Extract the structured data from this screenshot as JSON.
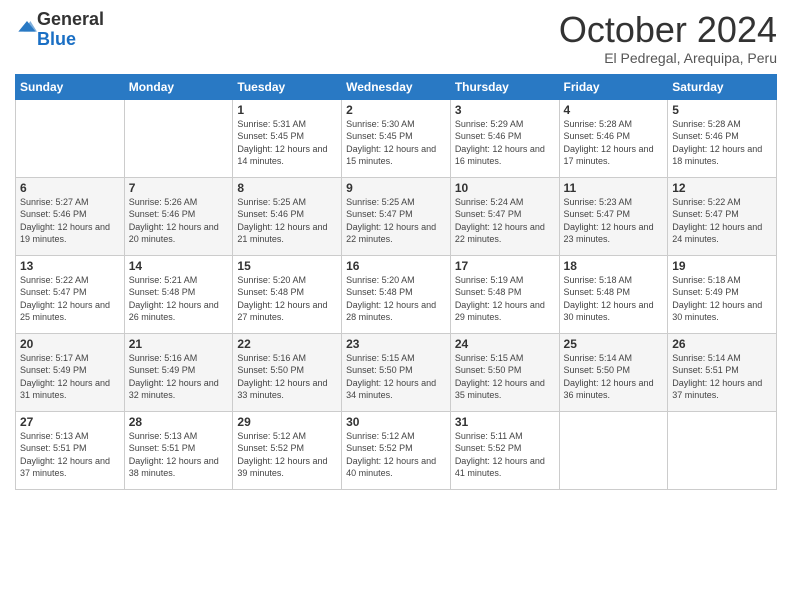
{
  "header": {
    "logo_general": "General",
    "logo_blue": "Blue",
    "month_title": "October 2024",
    "location": "El Pedregal, Arequipa, Peru"
  },
  "weekdays": [
    "Sunday",
    "Monday",
    "Tuesday",
    "Wednesday",
    "Thursday",
    "Friday",
    "Saturday"
  ],
  "weeks": [
    [
      {
        "day": "",
        "sunrise": "",
        "sunset": "",
        "daylight": ""
      },
      {
        "day": "",
        "sunrise": "",
        "sunset": "",
        "daylight": ""
      },
      {
        "day": "1",
        "sunrise": "Sunrise: 5:31 AM",
        "sunset": "Sunset: 5:45 PM",
        "daylight": "Daylight: 12 hours and 14 minutes."
      },
      {
        "day": "2",
        "sunrise": "Sunrise: 5:30 AM",
        "sunset": "Sunset: 5:45 PM",
        "daylight": "Daylight: 12 hours and 15 minutes."
      },
      {
        "day": "3",
        "sunrise": "Sunrise: 5:29 AM",
        "sunset": "Sunset: 5:46 PM",
        "daylight": "Daylight: 12 hours and 16 minutes."
      },
      {
        "day": "4",
        "sunrise": "Sunrise: 5:28 AM",
        "sunset": "Sunset: 5:46 PM",
        "daylight": "Daylight: 12 hours and 17 minutes."
      },
      {
        "day": "5",
        "sunrise": "Sunrise: 5:28 AM",
        "sunset": "Sunset: 5:46 PM",
        "daylight": "Daylight: 12 hours and 18 minutes."
      }
    ],
    [
      {
        "day": "6",
        "sunrise": "Sunrise: 5:27 AM",
        "sunset": "Sunset: 5:46 PM",
        "daylight": "Daylight: 12 hours and 19 minutes."
      },
      {
        "day": "7",
        "sunrise": "Sunrise: 5:26 AM",
        "sunset": "Sunset: 5:46 PM",
        "daylight": "Daylight: 12 hours and 20 minutes."
      },
      {
        "day": "8",
        "sunrise": "Sunrise: 5:25 AM",
        "sunset": "Sunset: 5:46 PM",
        "daylight": "Daylight: 12 hours and 21 minutes."
      },
      {
        "day": "9",
        "sunrise": "Sunrise: 5:25 AM",
        "sunset": "Sunset: 5:47 PM",
        "daylight": "Daylight: 12 hours and 22 minutes."
      },
      {
        "day": "10",
        "sunrise": "Sunrise: 5:24 AM",
        "sunset": "Sunset: 5:47 PM",
        "daylight": "Daylight: 12 hours and 22 minutes."
      },
      {
        "day": "11",
        "sunrise": "Sunrise: 5:23 AM",
        "sunset": "Sunset: 5:47 PM",
        "daylight": "Daylight: 12 hours and 23 minutes."
      },
      {
        "day": "12",
        "sunrise": "Sunrise: 5:22 AM",
        "sunset": "Sunset: 5:47 PM",
        "daylight": "Daylight: 12 hours and 24 minutes."
      }
    ],
    [
      {
        "day": "13",
        "sunrise": "Sunrise: 5:22 AM",
        "sunset": "Sunset: 5:47 PM",
        "daylight": "Daylight: 12 hours and 25 minutes."
      },
      {
        "day": "14",
        "sunrise": "Sunrise: 5:21 AM",
        "sunset": "Sunset: 5:48 PM",
        "daylight": "Daylight: 12 hours and 26 minutes."
      },
      {
        "day": "15",
        "sunrise": "Sunrise: 5:20 AM",
        "sunset": "Sunset: 5:48 PM",
        "daylight": "Daylight: 12 hours and 27 minutes."
      },
      {
        "day": "16",
        "sunrise": "Sunrise: 5:20 AM",
        "sunset": "Sunset: 5:48 PM",
        "daylight": "Daylight: 12 hours and 28 minutes."
      },
      {
        "day": "17",
        "sunrise": "Sunrise: 5:19 AM",
        "sunset": "Sunset: 5:48 PM",
        "daylight": "Daylight: 12 hours and 29 minutes."
      },
      {
        "day": "18",
        "sunrise": "Sunrise: 5:18 AM",
        "sunset": "Sunset: 5:48 PM",
        "daylight": "Daylight: 12 hours and 30 minutes."
      },
      {
        "day": "19",
        "sunrise": "Sunrise: 5:18 AM",
        "sunset": "Sunset: 5:49 PM",
        "daylight": "Daylight: 12 hours and 30 minutes."
      }
    ],
    [
      {
        "day": "20",
        "sunrise": "Sunrise: 5:17 AM",
        "sunset": "Sunset: 5:49 PM",
        "daylight": "Daylight: 12 hours and 31 minutes."
      },
      {
        "day": "21",
        "sunrise": "Sunrise: 5:16 AM",
        "sunset": "Sunset: 5:49 PM",
        "daylight": "Daylight: 12 hours and 32 minutes."
      },
      {
        "day": "22",
        "sunrise": "Sunrise: 5:16 AM",
        "sunset": "Sunset: 5:50 PM",
        "daylight": "Daylight: 12 hours and 33 minutes."
      },
      {
        "day": "23",
        "sunrise": "Sunrise: 5:15 AM",
        "sunset": "Sunset: 5:50 PM",
        "daylight": "Daylight: 12 hours and 34 minutes."
      },
      {
        "day": "24",
        "sunrise": "Sunrise: 5:15 AM",
        "sunset": "Sunset: 5:50 PM",
        "daylight": "Daylight: 12 hours and 35 minutes."
      },
      {
        "day": "25",
        "sunrise": "Sunrise: 5:14 AM",
        "sunset": "Sunset: 5:50 PM",
        "daylight": "Daylight: 12 hours and 36 minutes."
      },
      {
        "day": "26",
        "sunrise": "Sunrise: 5:14 AM",
        "sunset": "Sunset: 5:51 PM",
        "daylight": "Daylight: 12 hours and 37 minutes."
      }
    ],
    [
      {
        "day": "27",
        "sunrise": "Sunrise: 5:13 AM",
        "sunset": "Sunset: 5:51 PM",
        "daylight": "Daylight: 12 hours and 37 minutes."
      },
      {
        "day": "28",
        "sunrise": "Sunrise: 5:13 AM",
        "sunset": "Sunset: 5:51 PM",
        "daylight": "Daylight: 12 hours and 38 minutes."
      },
      {
        "day": "29",
        "sunrise": "Sunrise: 5:12 AM",
        "sunset": "Sunset: 5:52 PM",
        "daylight": "Daylight: 12 hours and 39 minutes."
      },
      {
        "day": "30",
        "sunrise": "Sunrise: 5:12 AM",
        "sunset": "Sunset: 5:52 PM",
        "daylight": "Daylight: 12 hours and 40 minutes."
      },
      {
        "day": "31",
        "sunrise": "Sunrise: 5:11 AM",
        "sunset": "Sunset: 5:52 PM",
        "daylight": "Daylight: 12 hours and 41 minutes."
      },
      {
        "day": "",
        "sunrise": "",
        "sunset": "",
        "daylight": ""
      },
      {
        "day": "",
        "sunrise": "",
        "sunset": "",
        "daylight": ""
      }
    ]
  ]
}
